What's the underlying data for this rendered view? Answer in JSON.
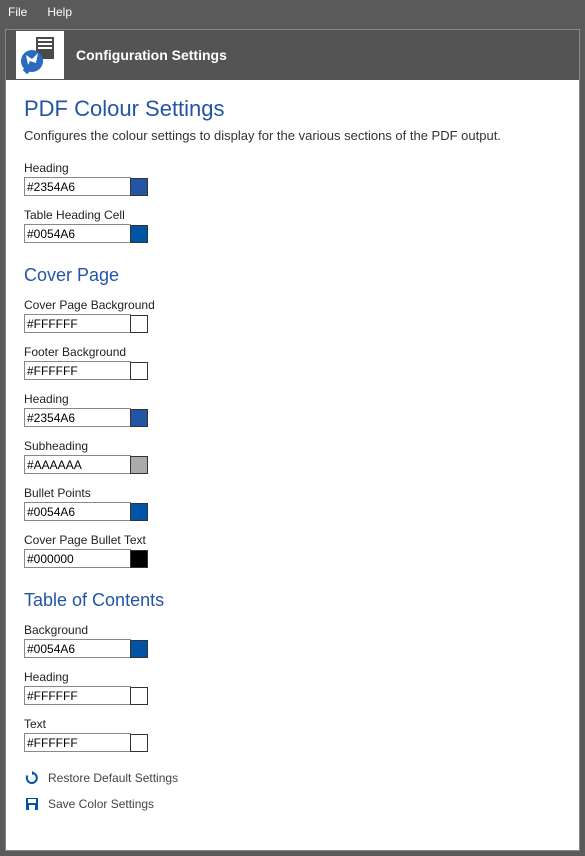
{
  "menu": {
    "file": "File",
    "help": "Help"
  },
  "header": {
    "title": "Configuration Settings"
  },
  "section1": {
    "title": "PDF Colour Settings",
    "desc": "Configures the colour settings to display for the various sections of the PDF output."
  },
  "fields": {
    "heading": {
      "label": "Heading",
      "value": "#2354A6",
      "color": "#2354A6"
    },
    "tableHeadingCell": {
      "label": "Table Heading Cell",
      "value": "#0054A6",
      "color": "#0054A6"
    }
  },
  "cover": {
    "title": "Cover Page",
    "bg": {
      "label": "Cover Page Background",
      "value": "#FFFFFF",
      "color": "#FFFFFF"
    },
    "footerBg": {
      "label": "Footer Background",
      "value": "#FFFFFF",
      "color": "#FFFFFF"
    },
    "heading": {
      "label": "Heading",
      "value": "#2354A6",
      "color": "#2354A6"
    },
    "subheading": {
      "label": "Subheading",
      "value": "#AAAAAA",
      "color": "#AAAAAA"
    },
    "bullets": {
      "label": "Bullet Points",
      "value": "#0054A6",
      "color": "#0054A6"
    },
    "bulletText": {
      "label": "Cover Page Bullet Text",
      "value": "#000000",
      "color": "#000000"
    }
  },
  "toc": {
    "title": "Table of Contents",
    "bg": {
      "label": "Background",
      "value": "#0054A6",
      "color": "#0054A6"
    },
    "heading": {
      "label": "Heading",
      "value": "#FFFFFF",
      "color": "#FFFFFF"
    },
    "text": {
      "label": "Text",
      "value": "#FFFFFF",
      "color": "#FFFFFF"
    }
  },
  "actions": {
    "restore": "Restore Default Settings",
    "save": "Save Color Settings"
  }
}
